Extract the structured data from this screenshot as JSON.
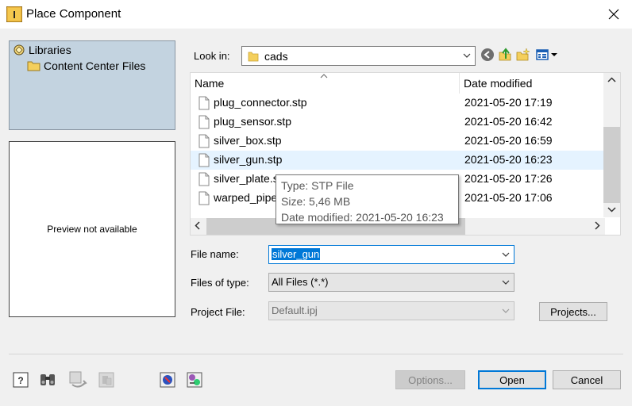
{
  "window": {
    "title": "Place Component",
    "app_icon_letter": "I",
    "app_icon_color": "#e8b13a"
  },
  "libraries": {
    "root_label": "Libraries",
    "child_label": "Content Center Files"
  },
  "preview": {
    "text": "Preview not available"
  },
  "look_in": {
    "label": "Look in:",
    "value": "cads"
  },
  "toolbar": {
    "icons": [
      "back-icon",
      "up-folder-icon",
      "new-folder-icon",
      "view-menu-icon"
    ]
  },
  "file_list": {
    "columns": {
      "name": "Name",
      "date": "Date modified"
    },
    "rows": [
      {
        "name": "plug_connector.stp",
        "date": "2021-05-20 17:19"
      },
      {
        "name": "plug_sensor.stp",
        "date": "2021-05-20 16:42"
      },
      {
        "name": "silver_box.stp",
        "date": "2021-05-20 16:59"
      },
      {
        "name": "silver_gun.stp",
        "date": "2021-05-20 16:23"
      },
      {
        "name": "silver_plate.stp",
        "date": "2021-05-20 17:26"
      },
      {
        "name": "warped_pipe.stp",
        "date": "2021-05-20 17:06"
      }
    ],
    "hovered_row": 3
  },
  "tooltip": {
    "type": "Type: STP File",
    "size": "Size: 5,46 MB",
    "modified": "Date modified: 2021-05-20 16:23"
  },
  "file_name": {
    "label": "File name:",
    "value": "silver_gun"
  },
  "files_of_type": {
    "label": "Files of type:",
    "value": "All Files (*.*)"
  },
  "project_file": {
    "label": "Project File:",
    "value": "Default.ipj"
  },
  "buttons": {
    "projects": "Projects...",
    "options": "Options...",
    "open": "Open",
    "cancel": "Cancel"
  },
  "bottom_icons": [
    "help-icon",
    "find-binoculars-icon",
    "refresh-icon",
    "disabled-tool-icon",
    "content-center-icon",
    "library-swap-icon"
  ],
  "colors": {
    "accent": "#0078d7",
    "library_panel": "#c3d3e0",
    "hover_row": "#e5f3ff"
  }
}
